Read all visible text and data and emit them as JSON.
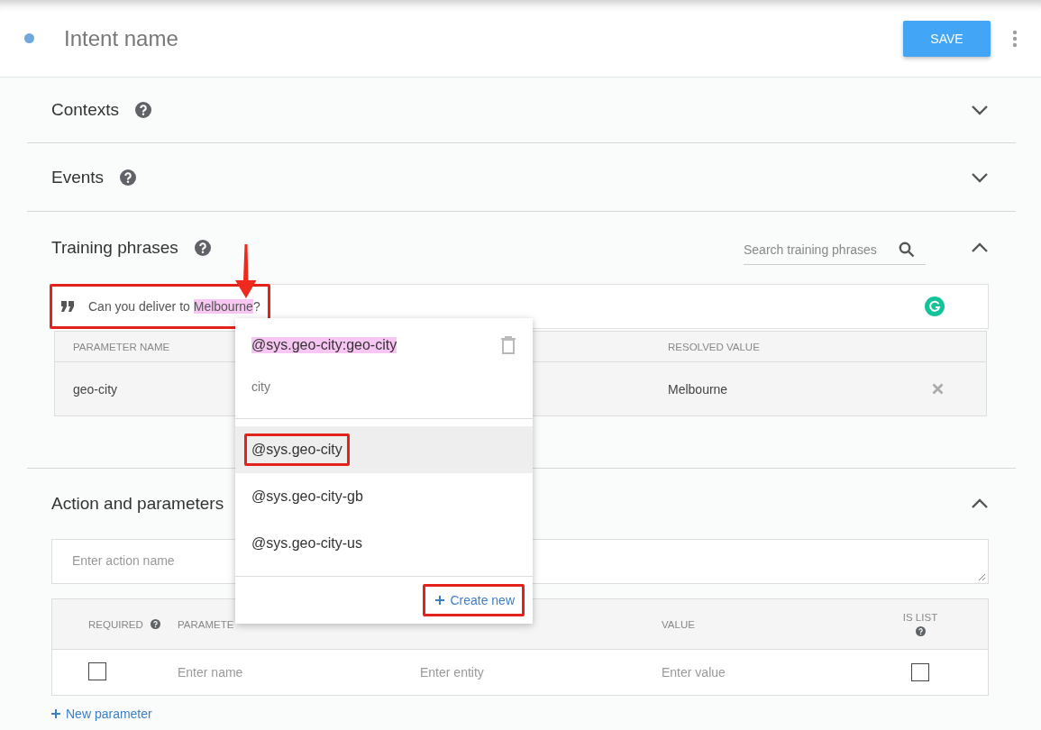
{
  "header": {
    "title_placeholder": "Intent name",
    "save_label": "SAVE"
  },
  "sections": [
    {
      "kind": "plain",
      "title": "Contexts",
      "help": true,
      "expanded": false
    },
    {
      "kind": "plain",
      "title": "Events",
      "help": true,
      "expanded": false
    },
    {
      "kind": "training",
      "title": "Training phrases",
      "help": true,
      "expanded": true,
      "search_placeholder": "Search training phrases",
      "phrase": {
        "text": "Can you deliver to ",
        "entity_text": "Melbourne",
        "end_text": "?",
        "annotated": true
      },
      "parameters": {
        "columns": [
          "PARAMETER NAME",
          "RESOLVED VALUE"
        ],
        "rows": [
          {
            "parameter_name": "geo-city",
            "resolved_value": "Melbourne"
          }
        ]
      },
      "entity_menu": {
        "entity": "@sys.geo-city:geo-city",
        "parameter": "city",
        "options": [
          {
            "label": "@sys.geo-city",
            "selected": true,
            "annotated": true
          },
          {
            "label": "@sys.geo-city-gb",
            "selected": false,
            "annotated": false
          },
          {
            "label": "@sys.geo-city-us",
            "selected": false,
            "annotated": false
          }
        ],
        "create_new": {
          "label": "Create new",
          "annotated": true
        }
      }
    },
    {
      "kind": "actions",
      "title": "Action and parameters",
      "help": false,
      "expanded": true,
      "action_placeholder": "Enter action name",
      "columns": [
        {
          "kind": "required",
          "label": "REQUIRED",
          "help": true
        },
        {
          "kind": "name",
          "label": "PARAMETE",
          "help": false
        },
        {
          "kind": "value",
          "label": "VALUE",
          "help": false
        },
        {
          "kind": "is_list",
          "label": "IS LIST",
          "help": true
        }
      ],
      "rows": [
        {
          "required": false,
          "name_placeholder": "Enter name",
          "entity_placeholder": "Enter entity",
          "value_placeholder": "Enter value",
          "is_list": false
        }
      ],
      "new_parameter": "New parameter"
    }
  ]
}
